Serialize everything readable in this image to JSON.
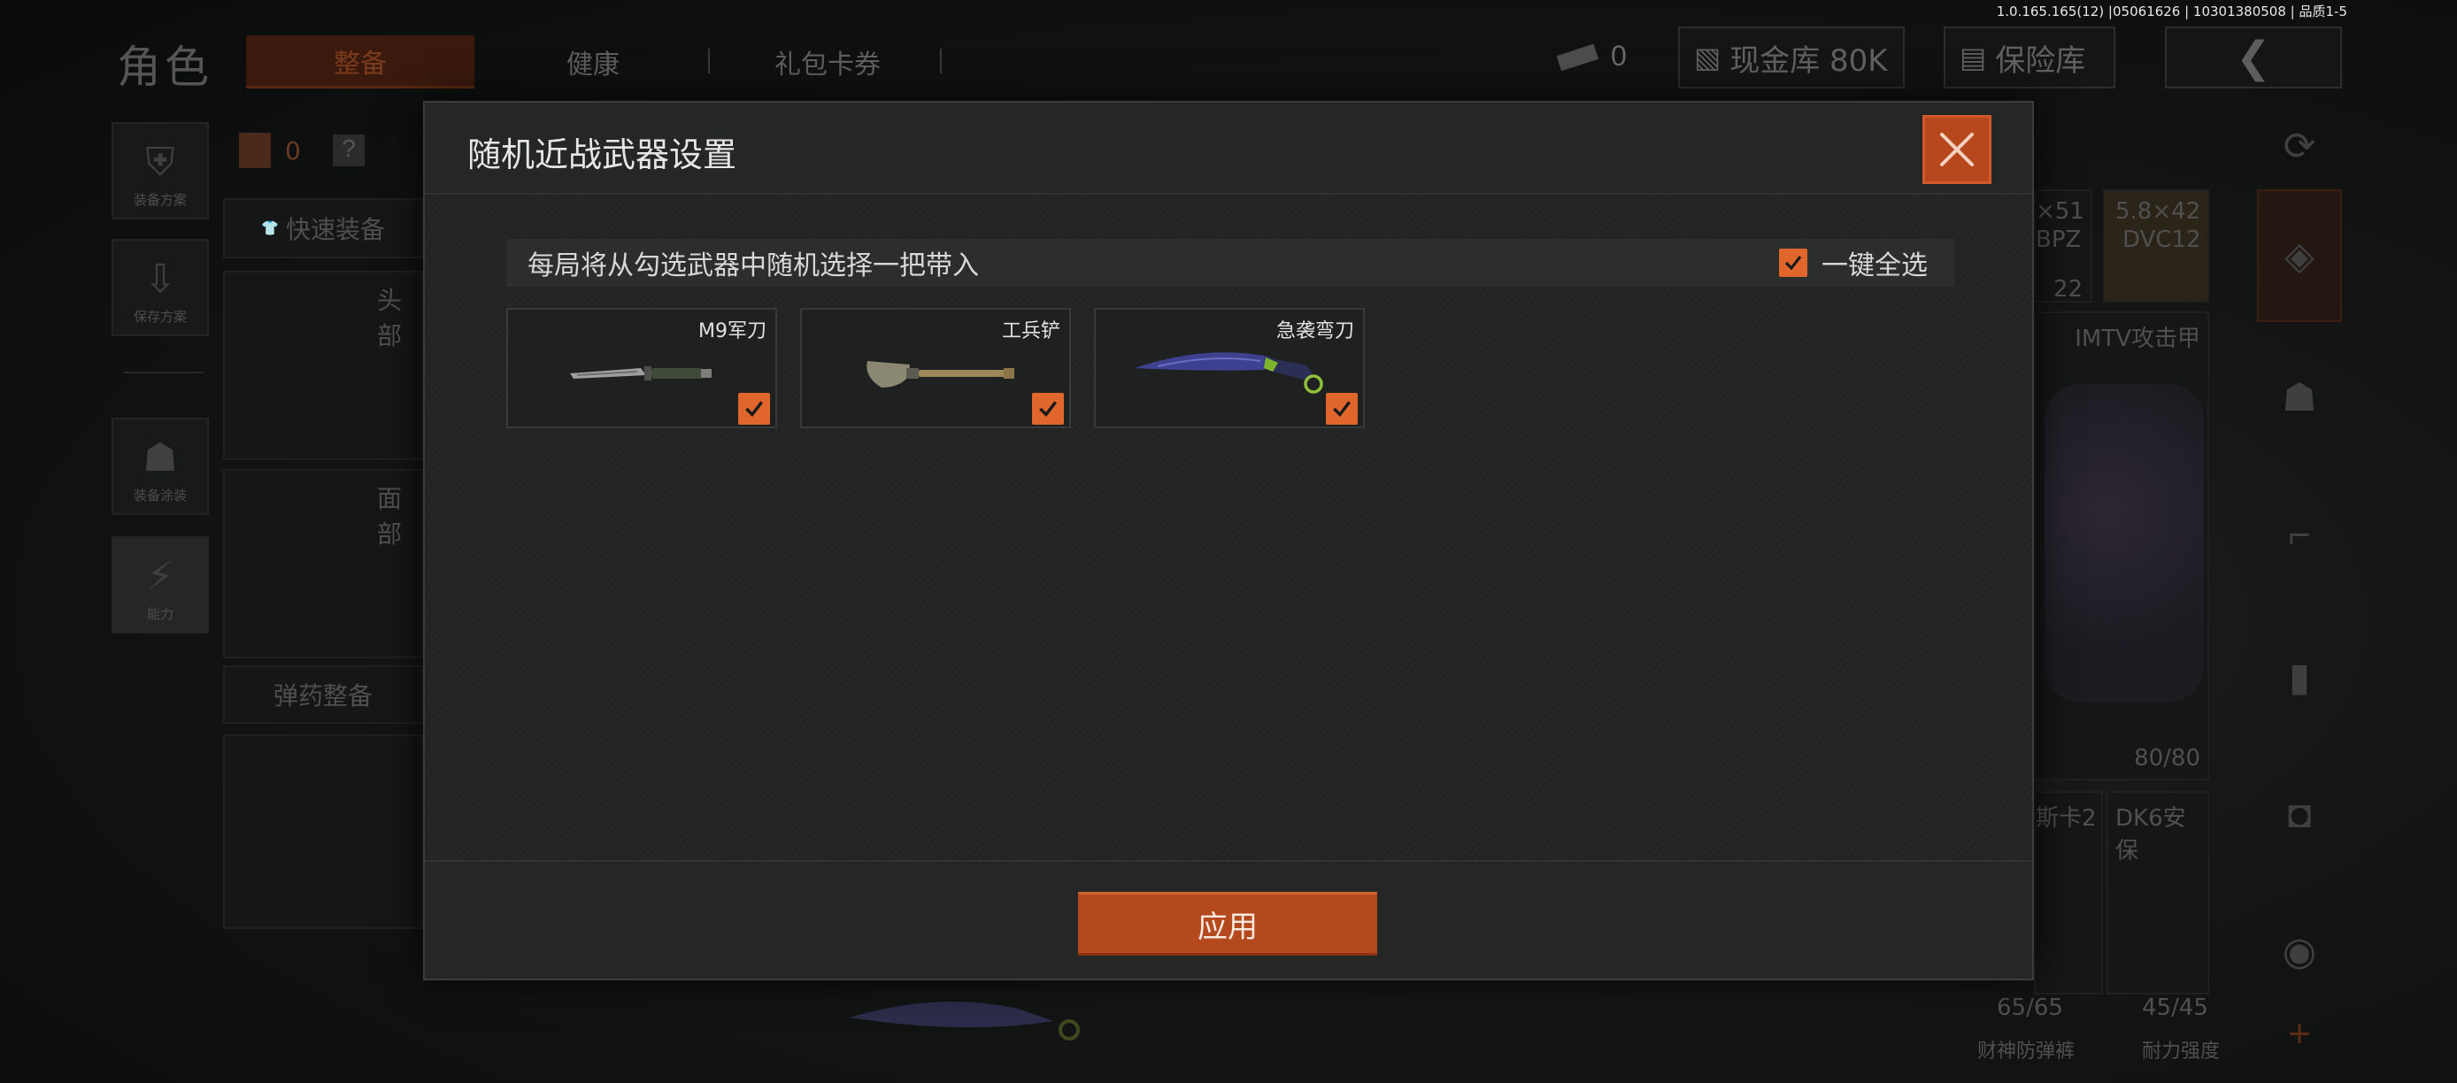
{
  "version_text": "1.0.165.165(12) |05061626 | 10301380508 | 品质1-5",
  "background": {
    "role_title": "角色",
    "tabs": [
      "整备",
      "健康",
      "礼包卡券"
    ],
    "coin_count": "0",
    "cash_vault_label": "现金库 80K",
    "safe_vault_label": "保险库",
    "left_rail": [
      "装备方案",
      "保存方案",
      "装备涂装",
      "能力"
    ],
    "bag_count": "0",
    "quick_equip_label": "快速装备",
    "slot_head": "头部",
    "slot_face": "面部",
    "ammo_label": "弹药整备",
    "ammo_items": [
      {
        "name": "×51",
        "sub": "BPZ",
        "count": "22"
      },
      {
        "name": "5.8×42",
        "sub": "DVC12",
        "count": ""
      }
    ],
    "armor_name": "IMTV攻击甲",
    "armor_durability": "80/80",
    "item_a_name": "斯卡2",
    "item_b_name": "DK6安保",
    "item_a_stat": "65/65",
    "item_b_stat": "45/45",
    "item_a_label": "财神防弹裤",
    "item_b_label": "耐力强度"
  },
  "modal": {
    "title": "随机近战武器设置",
    "subheader": "每局将从勾选武器中随机选择一把带入",
    "select_all_label": "一键全选",
    "select_all_checked": true,
    "weapons": [
      {
        "name": "M9军刀",
        "checked": true,
        "icon": "knife-icon"
      },
      {
        "name": "工兵铲",
        "checked": true,
        "icon": "shovel-icon"
      },
      {
        "name": "急袭弯刀",
        "checked": true,
        "icon": "karambit-icon"
      }
    ],
    "apply_label": "应用"
  },
  "colors": {
    "accent": "#e0662c",
    "button": "#b5491e",
    "modal_bg": "#212222"
  }
}
